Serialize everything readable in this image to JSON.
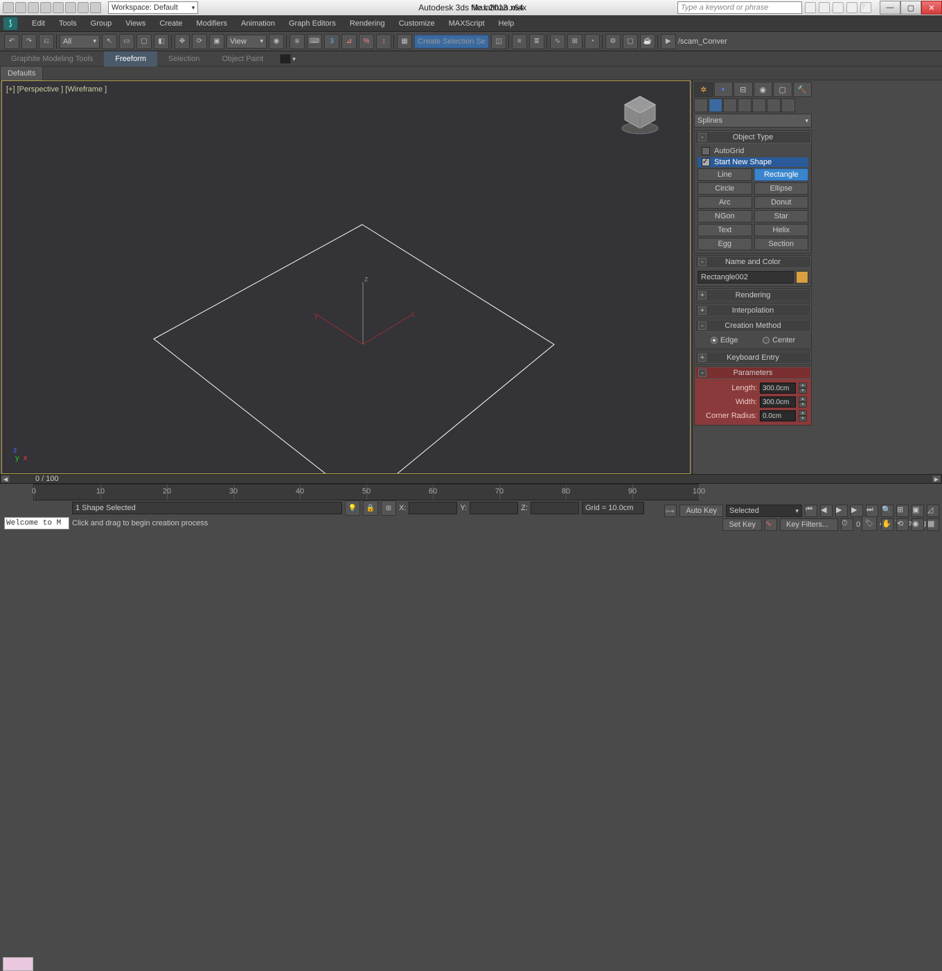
{
  "titlebar": {
    "workspace": "Workspace: Default",
    "appname": "Autodesk 3ds Max  2013 x64",
    "filename": "file latihan.max",
    "search_placeholder": "Type a keyword or phrase"
  },
  "menu": [
    "Edit",
    "Tools",
    "Group",
    "Views",
    "Create",
    "Modifiers",
    "Animation",
    "Graph Editors",
    "Rendering",
    "Customize",
    "MAXScript",
    "Help"
  ],
  "toolbar": {
    "all": "All",
    "view": "View",
    "css_label": "Create Selection Se",
    "script": "/scam_Conver"
  },
  "ribbon": {
    "tabs": [
      "Graphite Modeling Tools",
      "Freeform",
      "Selection",
      "Object Paint"
    ],
    "active": 1,
    "sub": "Defaults"
  },
  "viewport": {
    "label": "[+] [Perspective ] [Wireframe ]",
    "axes": {
      "x": "x",
      "y": "y",
      "z": "z"
    }
  },
  "cmd": {
    "category": "Splines",
    "objtype_title": "Object Type",
    "autogrid": "AutoGrid",
    "startnew": "Start New Shape",
    "buttons": [
      [
        "Line",
        "Rectangle"
      ],
      [
        "Circle",
        "Ellipse"
      ],
      [
        "Arc",
        "Donut"
      ],
      [
        "NGon",
        "Star"
      ],
      [
        "Text",
        "Helix"
      ],
      [
        "Egg",
        "Section"
      ]
    ],
    "active_btn": "Rectangle",
    "name_title": "Name and Color",
    "objname": "Rectangle002",
    "rolls": [
      "Rendering",
      "Interpolation",
      "Creation Method",
      "Keyboard Entry",
      "Parameters"
    ],
    "cm_edge": "Edge",
    "cm_center": "Center",
    "params": {
      "length_l": "Length:",
      "length_v": "300.0cm",
      "width_l": "Width:",
      "width_v": "300.0cm",
      "cr_l": "Corner Radius:",
      "cr_v": "0.0cm"
    }
  },
  "timeline": {
    "pos": "0 / 100",
    "ticks": [
      0,
      10,
      20,
      30,
      40,
      50,
      60,
      70,
      80,
      90,
      100
    ]
  },
  "status": {
    "sel": "1 Shape Selected",
    "prompt": "Click and drag to begin creation process",
    "welcome": "Welcome to M",
    "x": "X:",
    "y": "Y:",
    "z": "Z:",
    "grid": "Grid = 10.0cm",
    "xtag": "",
    "ytag": "",
    "ztag": "",
    "autokey": "Auto Key",
    "setkey": "Set Key",
    "selected": "Selected",
    "keyfilters": "Key Filters...",
    "addtag": "Add Time Tag"
  }
}
